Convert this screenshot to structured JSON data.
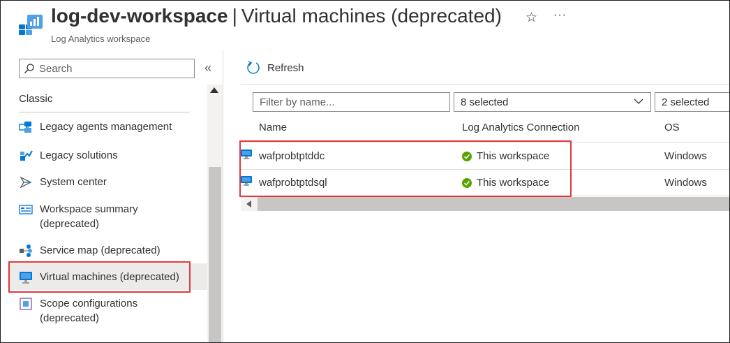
{
  "header": {
    "resource_name": "log-dev-workspace",
    "separator": "|",
    "page_title": "Virtual machines (deprecated)",
    "subtitle": "Log Analytics workspace",
    "favorite_icon": "star-icon",
    "more_icon": "ellipsis-icon",
    "more_glyph": "···"
  },
  "sidebar": {
    "search_placeholder": "Search",
    "collapse_glyph": "«",
    "section_heading": "Classic",
    "items": [
      {
        "label": "Legacy agents management",
        "icon": "legacy-agents-icon"
      },
      {
        "label": "Legacy solutions",
        "icon": "legacy-solutions-icon"
      },
      {
        "label": "System center",
        "icon": "system-center-icon"
      },
      {
        "label": "Workspace summary (deprecated)",
        "icon": "workspace-summary-icon"
      },
      {
        "label": "Service map (deprecated)",
        "icon": "service-map-icon"
      },
      {
        "label": "Virtual machines (deprecated)",
        "icon": "virtual-machine-icon",
        "selected": true
      },
      {
        "label": "Scope configurations (deprecated)",
        "icon": "scope-configurations-icon"
      }
    ]
  },
  "toolbar": {
    "refresh_label": "Refresh"
  },
  "filters": {
    "name_placeholder": "Filter by name...",
    "connection_dropdown": "8 selected",
    "os_dropdown": "2 selected"
  },
  "table": {
    "columns": [
      "Name",
      "Log Analytics Connection",
      "OS"
    ],
    "rows": [
      {
        "name": "wafprobtptddc",
        "connection": "This workspace",
        "os": "Windows"
      },
      {
        "name": "wafprobtptdsql",
        "connection": "This workspace",
        "os": "Windows"
      }
    ]
  },
  "colors": {
    "accent": "#0078d4",
    "highlight": "#e0393e",
    "success": "#57a300",
    "selected_bg": "#edebe9"
  }
}
